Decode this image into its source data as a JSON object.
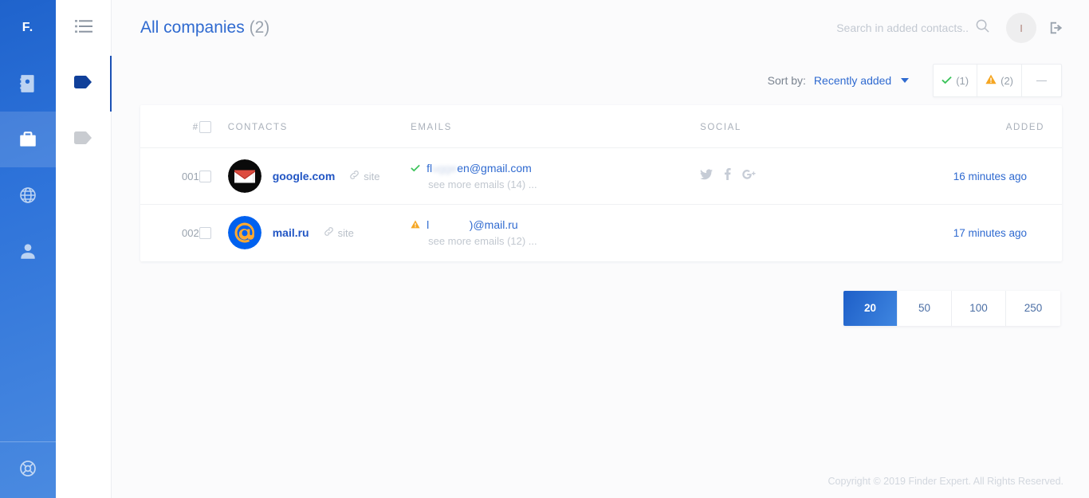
{
  "sidebar": {
    "brand": "F.",
    "items": [
      {
        "name": "contacts-book",
        "icon": "address-book-icon",
        "active": false
      },
      {
        "name": "companies",
        "icon": "briefcase-icon",
        "active": true
      },
      {
        "name": "domains",
        "icon": "globe-icon",
        "active": false
      },
      {
        "name": "people",
        "icon": "person-icon",
        "active": false
      }
    ],
    "bottom": {
      "name": "support",
      "icon": "lifebuoy-icon"
    }
  },
  "rail2": {
    "items": [
      {
        "name": "list-view",
        "icon": "list-icon",
        "active": false
      },
      {
        "name": "tag-primary",
        "icon": "tag-icon",
        "active": true
      },
      {
        "name": "tag-secondary",
        "icon": "tag-icon",
        "active": false
      }
    ]
  },
  "header": {
    "title": "All companies",
    "count": "(2)",
    "search_placeholder": "Search in added contacts..",
    "search_value": "",
    "avatar_initial": "I"
  },
  "toolbar": {
    "sort_label": "Sort by:",
    "sort_value": "Recently added",
    "filters": [
      {
        "icon": "check-icon",
        "label": "(1)"
      },
      {
        "icon": "warning-icon",
        "label": "(2)"
      },
      {
        "icon": "dash-icon",
        "label": ""
      }
    ]
  },
  "table": {
    "columns": [
      "#",
      "CONTACTS",
      "EMAILS",
      "SOCIAL",
      "ADDED"
    ],
    "rows": [
      {
        "num": "001",
        "domain": "google.com",
        "site_label": "site",
        "logo": "gmail-logo",
        "status": "verified",
        "email_prefix": "fl",
        "email_hidden": "ugge",
        "email_suffix": "en@gmail.com",
        "see_more": "see more emails (14) ...",
        "social": [
          "twitter-icon",
          "facebook-icon",
          "googleplus-icon"
        ],
        "added": "16 minutes ago"
      },
      {
        "num": "002",
        "domain": "mail.ru",
        "site_label": "site",
        "logo": "mailru-logo",
        "status": "warning",
        "email_prefix": "l",
        "email_hidden": "             ",
        "email_suffix": ")@mail.ru",
        "see_more": "see more emails (12) ...",
        "social": [],
        "added": "17 minutes ago"
      }
    ]
  },
  "pagination": {
    "options": [
      "20",
      "50",
      "100",
      "250"
    ],
    "active": "20"
  },
  "footer": {
    "copyright": "Copyright © 2019 Finder Expert. All Rights Reserved."
  },
  "colors": {
    "brand_blue": "#2f6ad0",
    "deep_blue": "#2256c4",
    "success": "#3cc35b",
    "warning": "#f5a623"
  }
}
